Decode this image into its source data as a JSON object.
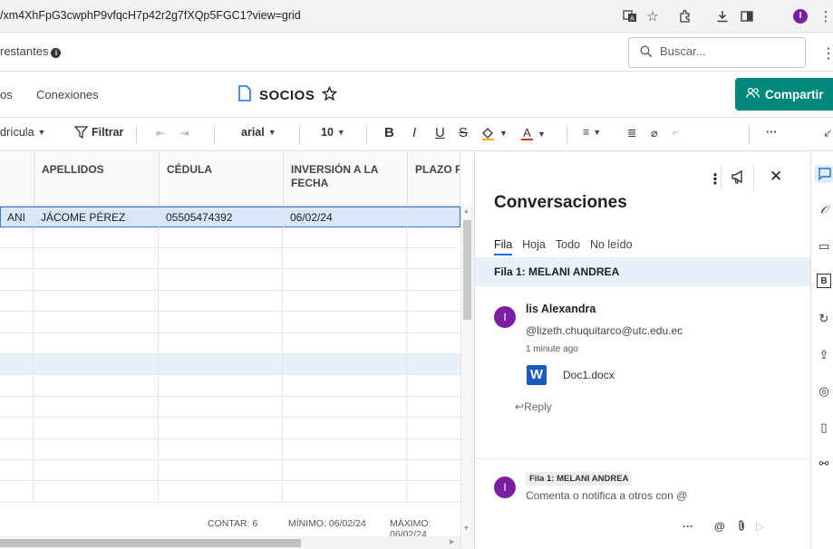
{
  "browser": {
    "url": "/xm4XhFpG3cwphP9vfqcH7p42r2g7fXQp5FGC1?view=grid",
    "profile_initial": "I"
  },
  "workspace": {
    "title_fragment": "restantes",
    "search_placeholder": "Buscar..."
  },
  "nav": {
    "items": [
      "os",
      "Conexiones"
    ],
    "doc_title": "SOCIOS",
    "share_label": "Compartir"
  },
  "toolbar": {
    "view_label": "drícula",
    "filter_label": "Filtrar",
    "font": "arial",
    "font_size": "10",
    "bold": "B",
    "italic": "I",
    "underline": "U",
    "strike": "S",
    "more": "···"
  },
  "grid": {
    "columns": [
      "APELLIDOS",
      "CÉDULA",
      "INVERSIÓN A LA FECHA",
      "PLAZO FIJO"
    ],
    "rows": [
      [
        "ANI",
        "JÁCOME PÉREZ",
        "05505474392",
        "06/02/24",
        ""
      ]
    ],
    "stats": {
      "count": "CONTAR: 6",
      "min": "MÍNIMO: 06/02/24",
      "max": "MÁXIMO: 06/02/24"
    }
  },
  "conversations": {
    "title": "Conversaciones",
    "tabs": [
      "Fila",
      "Hoja",
      "Todo",
      "No leído"
    ],
    "row_label": "Fila 1: MELANI ANDREA",
    "comment": {
      "avatar": "I",
      "author": "lis Alexandra",
      "mention": "@lizeth.chuquitarco@utc.edu.ec",
      "time": "1 minute ago",
      "attachment": "Doc1.docx",
      "reply": "Reply"
    },
    "compose": {
      "avatar": "I",
      "chip": "Fila 1: MELANI ANDREA",
      "placeholder": "Comenta o notifica a otros con @",
      "more": "···",
      "at": "@"
    }
  },
  "colors": {
    "share_bg": "#00897b",
    "avatar_bg": "#7b1fa2",
    "selection_bg": "#d8e6f7",
    "word_blue": "#185abd"
  }
}
